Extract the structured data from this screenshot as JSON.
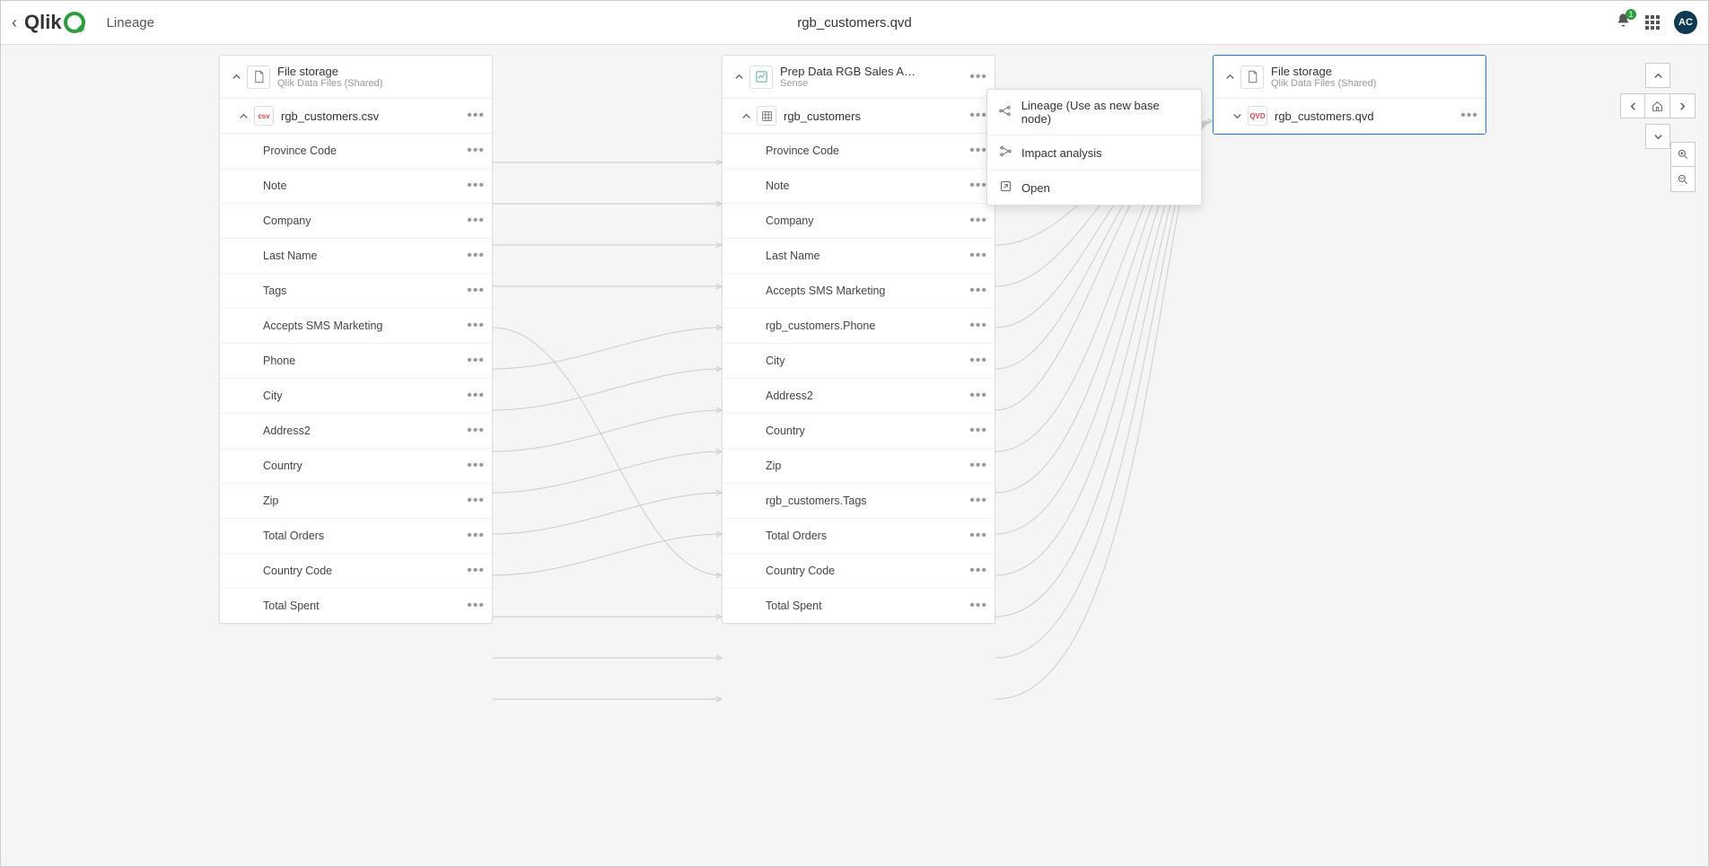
{
  "header": {
    "page_label": "Lineage",
    "title": "rgb_customers.qvd",
    "notification_count": "1",
    "avatar": "AC"
  },
  "ctx_menu": {
    "lineage": "Lineage (Use as new base node)",
    "impact": "Impact analysis",
    "open": "Open"
  },
  "nodes": {
    "left": {
      "title": "File storage",
      "sub": "Qlik Data Files (Shared)",
      "file": "rgb_customers.csv",
      "fields": [
        "Province Code",
        "Note",
        "Company",
        "Last Name",
        "Tags",
        "Accepts SMS Marketing",
        "Phone",
        "City",
        "Address2",
        "Country",
        "Zip",
        "Total Orders",
        "Country Code",
        "Total Spent"
      ]
    },
    "mid": {
      "title": "Prep Data RGB Sales A…",
      "sub": "Sense",
      "file": "rgb_customers",
      "fields": [
        "Province Code",
        "Note",
        "Company",
        "Last Name",
        "Accepts SMS Marketing",
        "rgb_customers.Phone",
        "City",
        "Address2",
        "Country",
        "Zip",
        "rgb_customers.Tags",
        "Total Orders",
        "Country Code",
        "Total Spent"
      ]
    },
    "right": {
      "title": "File storage",
      "sub": "Qlik Data Files (Shared)",
      "file": "rgb_customers.qvd"
    }
  }
}
